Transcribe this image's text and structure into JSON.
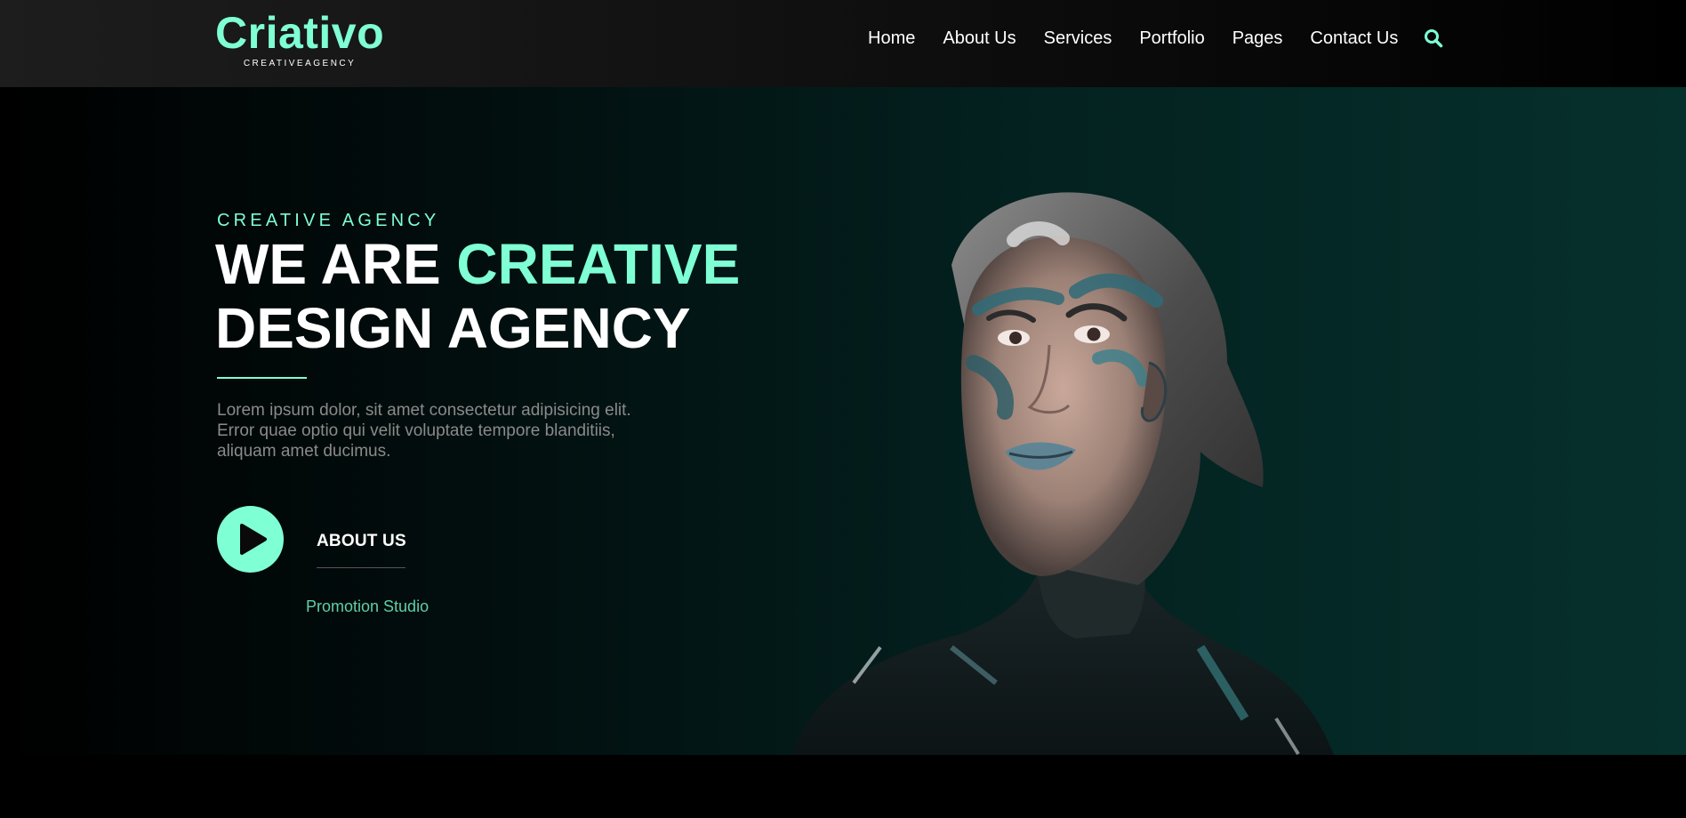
{
  "brand": {
    "name": "Criativo",
    "tagline": "CREATIVEAGENCY",
    "accent_color": "#7fffd4"
  },
  "nav": {
    "items": [
      {
        "label": "Home"
      },
      {
        "label": "About Us"
      },
      {
        "label": "Services"
      },
      {
        "label": "Portfolio"
      },
      {
        "label": "Pages"
      },
      {
        "label": "Contact Us"
      }
    ],
    "search_icon": "search-icon"
  },
  "hero": {
    "eyebrow": "CREATIVE AGENCY",
    "headline_part1": "WE ARE ",
    "headline_accent": "CREATIVE",
    "headline_line2": "DESIGN AGENCY",
    "body_line1": "Lorem ipsum dolor, sit amet consectetur adipisicing elit.",
    "body_line2": "Error quae optio qui velit voluptate tempore blanditiis,",
    "body_line3": "aliquam amet ducimus.",
    "play_icon": "play-icon",
    "about_label": "ABOUT US",
    "promo_label": "Promotion Studio",
    "portrait_image": "portrait-woman-with-teal-face-paint"
  }
}
